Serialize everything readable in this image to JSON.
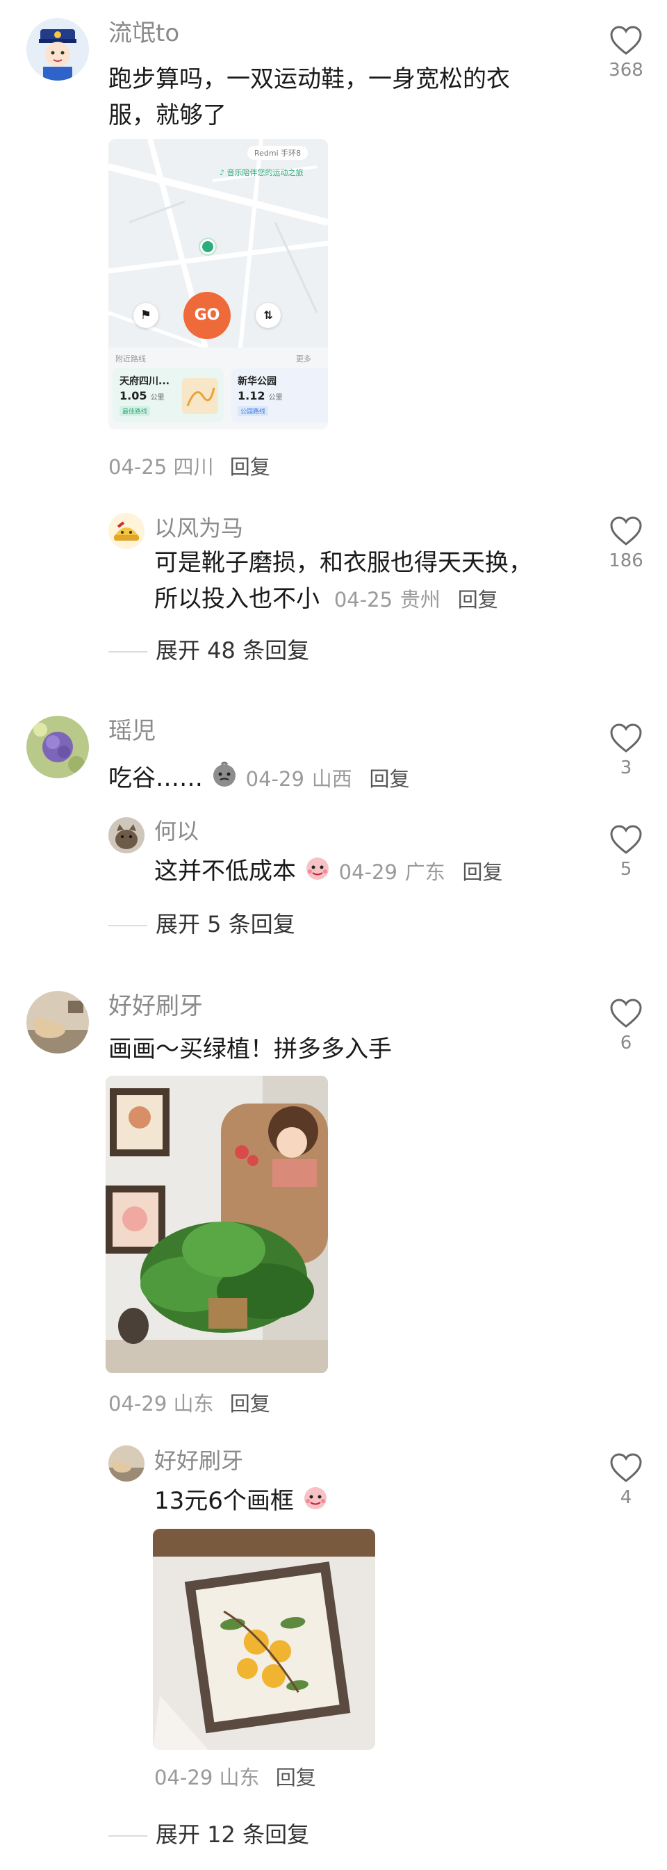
{
  "comments": [
    {
      "user": "流氓to",
      "text": "跑步算吗，一双运动鞋，一身宽松的衣服，就够了",
      "date": "04-25",
      "region": "四川",
      "reply_label": "回复",
      "likes": "368",
      "map": {
        "brand": "Redmi 手环8",
        "banner": "音乐陪伴您的运动之旅",
        "go_label": "GO",
        "nearby_label": "附近路线",
        "more_label": "更多",
        "route1_name": "天府四川...",
        "route1_dist": "1.05",
        "route1_unit": "公里",
        "route1_tag": "最佳路线",
        "route2_name": "新华公园",
        "route2_dist": "1.12",
        "route2_unit": "公里",
        "route2_tag": "公园路线"
      }
    },
    {
      "user": "以风为马",
      "text_line1": "可是靴子磨损，和衣服也得天天换，",
      "text_line2": "所以投入也不小",
      "date": "04-25",
      "region": "贵州",
      "reply_label": "回复",
      "likes": "186"
    },
    {
      "user": "瑶児",
      "text": "吃谷……",
      "date": "04-29",
      "region": "山西",
      "reply_label": "回复",
      "likes": "3"
    },
    {
      "user": "何以",
      "text": "这并不低成本",
      "date": "04-29",
      "region": "广东",
      "reply_label": "回复",
      "likes": "5"
    },
    {
      "user": "好好刷牙",
      "text": "画画～买绿植！拼多多入手",
      "date": "04-29",
      "region": "山东",
      "reply_label": "回复",
      "likes": "6"
    },
    {
      "user": "好好刷牙",
      "text": "13元6个画框",
      "date": "04-29",
      "region": "山东",
      "reply_label": "回复",
      "likes": "4"
    }
  ],
  "expand": {
    "first": "展开 48 条回复",
    "second": "展开 5 条回复",
    "third": "展开 12 条回复"
  },
  "icons": [
    "heart-outline-icon",
    "flag-icon",
    "route-icon",
    "location-dot-icon",
    "music-icon"
  ],
  "colors": {
    "go_button": "#ef6a3a",
    "map_pin": "#2cae7c",
    "text": "#1a1a1a",
    "meta": "#9a9a9a"
  }
}
